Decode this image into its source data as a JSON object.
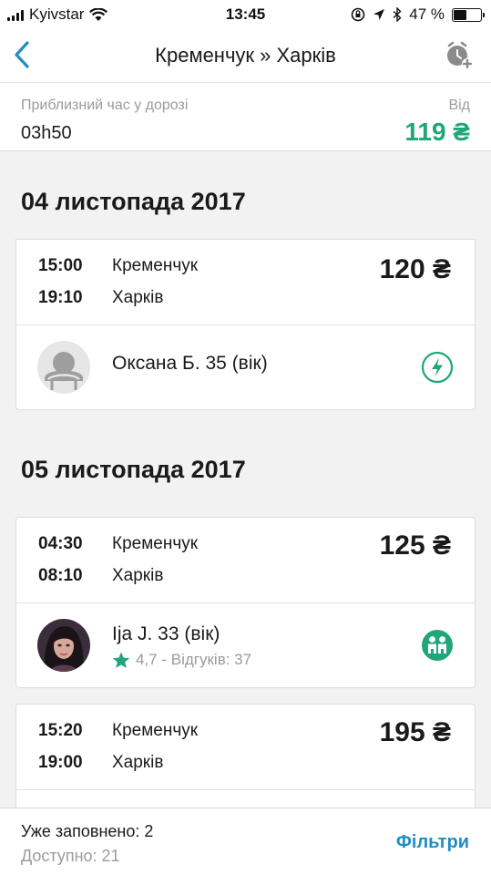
{
  "status_bar": {
    "carrier": "Kyivstar",
    "time": "13:45",
    "battery": "47 %",
    "battery_level": 0.47
  },
  "nav": {
    "title": "Кременчук » Харків",
    "back_icon": "chevron-left-icon",
    "alarm_icon": "alarm-add-icon"
  },
  "summary": {
    "duration_label": "Приблизний час у дорозі",
    "duration_value": "03h50",
    "from_label": "Від",
    "from_price": "119 ₴",
    "accent_color": "#1fa67a"
  },
  "days": [
    {
      "date": "04 листопада 2017",
      "trips": [
        {
          "departure_time": "15:00",
          "departure_city": "Кременчук",
          "arrival_time": "19:10",
          "arrival_city": "Харків",
          "price": "120 ₴",
          "driver": "Оксана Б. 35 (вік)",
          "avatar": "default-avatar-icon",
          "badge": "instant-booking-icon"
        }
      ]
    },
    {
      "date": "05 листопада 2017",
      "trips": [
        {
          "departure_time": "04:30",
          "departure_city": "Кременчук",
          "arrival_time": "08:10",
          "arrival_city": "Харків",
          "price": "125 ₴",
          "driver": "Ija J. 33 (вік)",
          "rating": "4,7 - Відгуків: 37",
          "avatar": "user-photo",
          "badge": "passengers-icon"
        },
        {
          "departure_time": "15:20",
          "departure_city": "Кременчук",
          "arrival_time": "19:00",
          "arrival_city": "Харків",
          "price": "195 ₴"
        }
      ]
    }
  ],
  "footer": {
    "booked": "Уже заповнено: 2",
    "available": "Доступно: 21",
    "filters": "Фільтри",
    "link_color": "#1f8ec5"
  }
}
